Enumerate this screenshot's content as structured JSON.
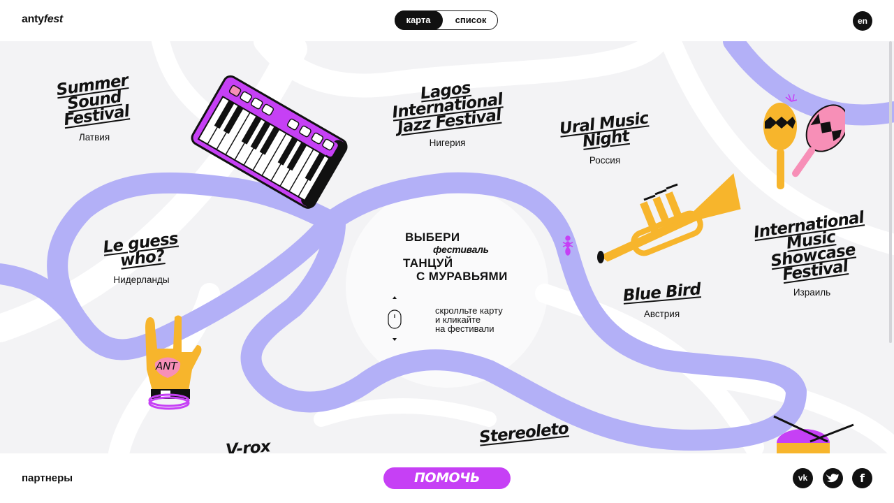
{
  "header": {
    "logo_part1": "anty",
    "logo_part2": "fest",
    "view_toggle": {
      "map_label": "карта",
      "list_label": "список",
      "active": "map"
    },
    "lang_label": "en"
  },
  "center": {
    "line1": "ВЫБЕРИ",
    "line2": "фестиваль",
    "line3": "ТАНЦУЙ",
    "line4": "С МУРАВЬЯМИ",
    "hint": "скролльте карту\nи кликайте\nна фестивали"
  },
  "festivals": [
    {
      "name": "Summer Sound Festival",
      "country": "Латвия"
    },
    {
      "name": "Lagos International Jazz Festival",
      "country": "Нигерия"
    },
    {
      "name": "Ural Music Night",
      "country": "Россия"
    },
    {
      "name": "Le guess who?",
      "country": "Нидерланды"
    },
    {
      "name": "International Music Showcase Festival",
      "country": "Израиль"
    },
    {
      "name": "Blue Bird",
      "country": "Австрия"
    },
    {
      "name": "Stereoleto",
      "country": ""
    },
    {
      "name": "V-rox",
      "country": ""
    }
  ],
  "footer": {
    "partners_label": "партнеры",
    "help_label": "ПОМОЧЬ",
    "social": [
      {
        "icon": "vk-icon",
        "label": "vk"
      },
      {
        "icon": "twitter-icon",
        "label": ""
      },
      {
        "icon": "facebook-icon",
        "label": "f"
      }
    ]
  },
  "colors": {
    "river": "#b3b0f7",
    "accent": "#c640f5",
    "map_bg": "#f3f3f5",
    "orange": "#f7b52c",
    "pink": "#f78fb7"
  }
}
